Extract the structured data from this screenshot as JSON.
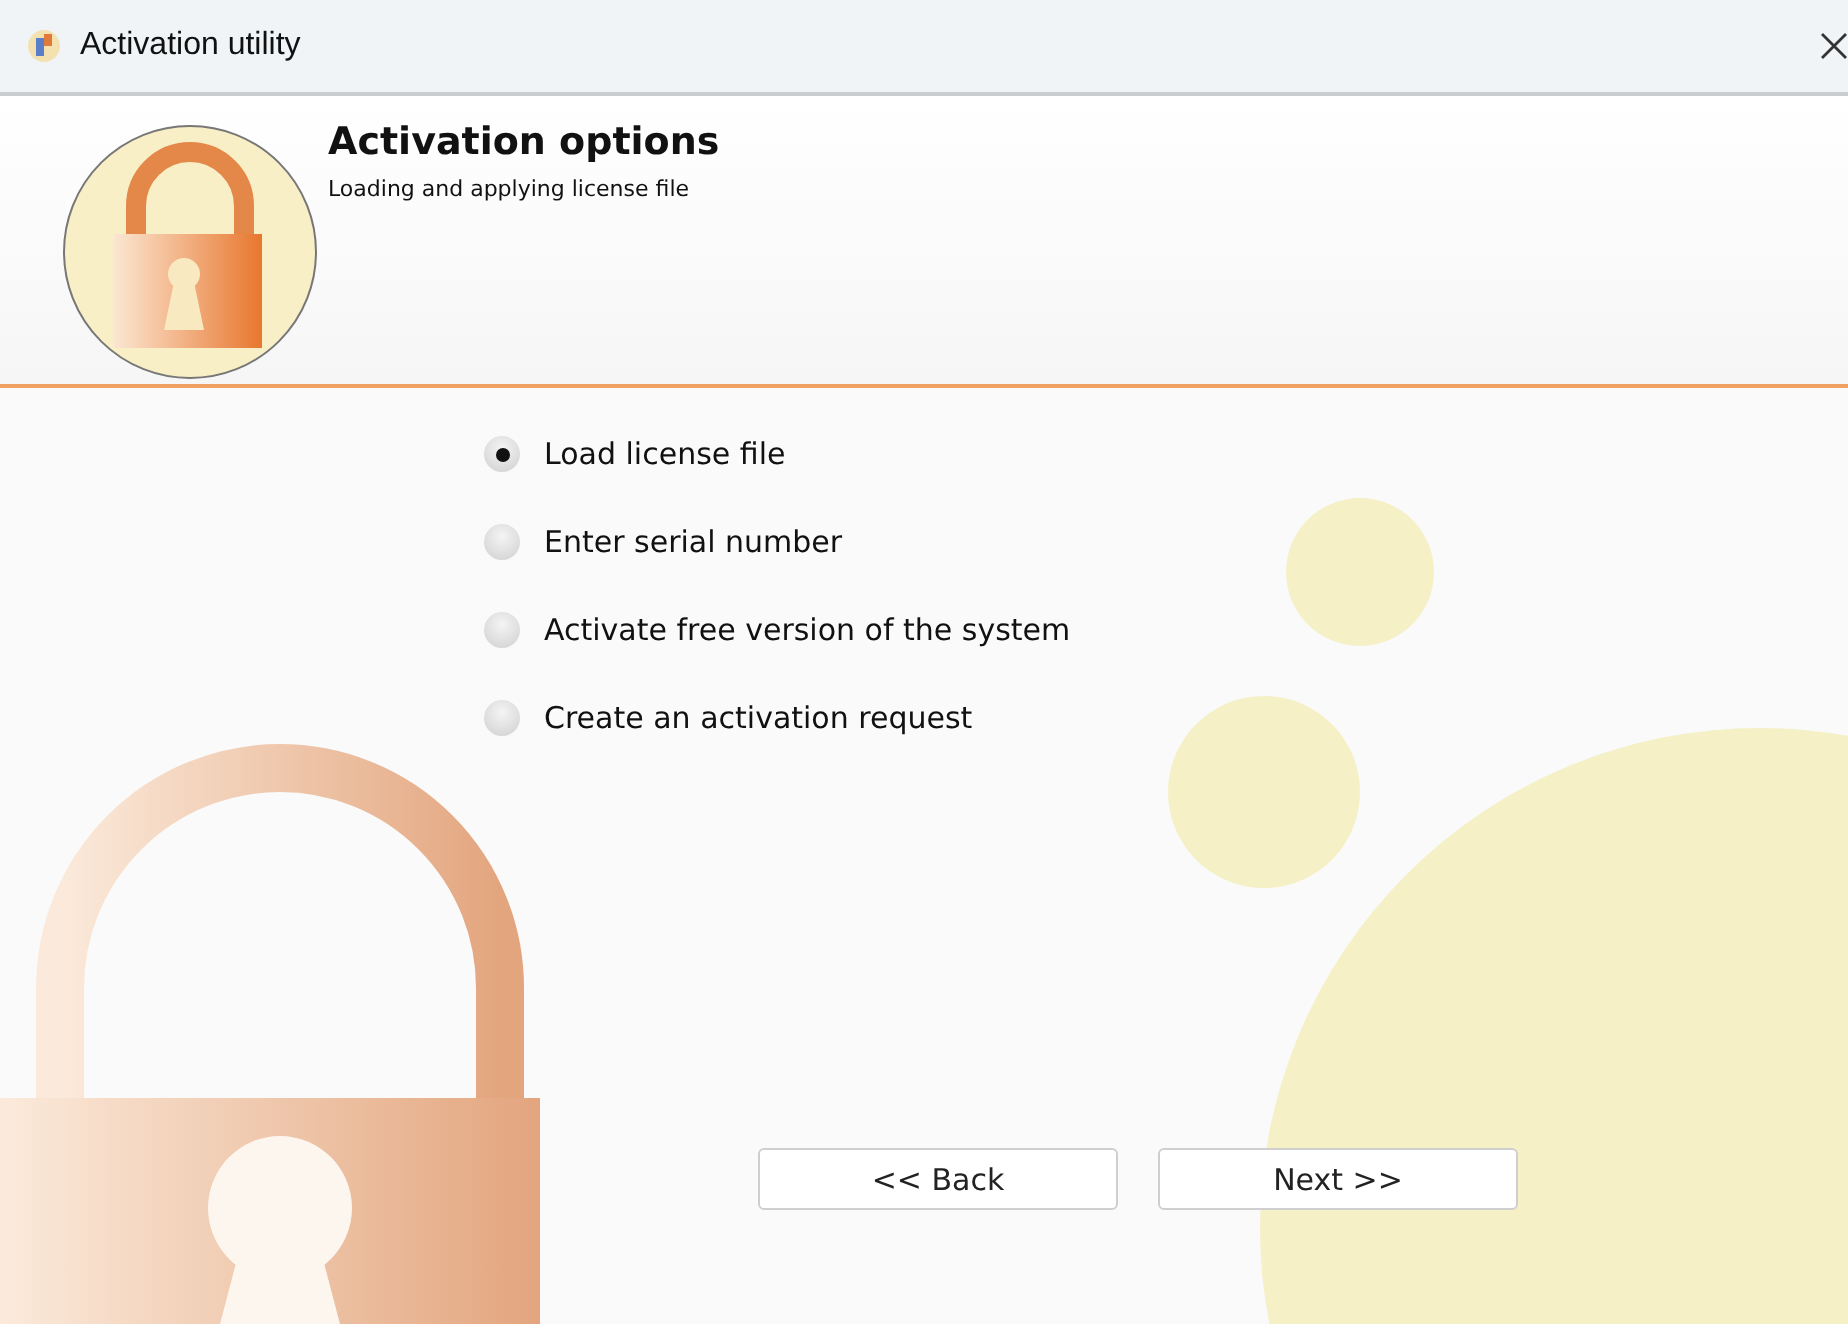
{
  "window": {
    "title": "Activation utility"
  },
  "header": {
    "title": "Activation options",
    "subtitle": "Loading and applying license file"
  },
  "options": [
    {
      "label": "Load license file",
      "selected": true
    },
    {
      "label": "Enter serial number",
      "selected": false
    },
    {
      "label": "Activate free version of the system",
      "selected": false
    },
    {
      "label": "Create an activation request",
      "selected": false
    }
  ],
  "buttons": [
    {
      "label": "<< Back"
    },
    {
      "label": "Next >>"
    }
  ]
}
